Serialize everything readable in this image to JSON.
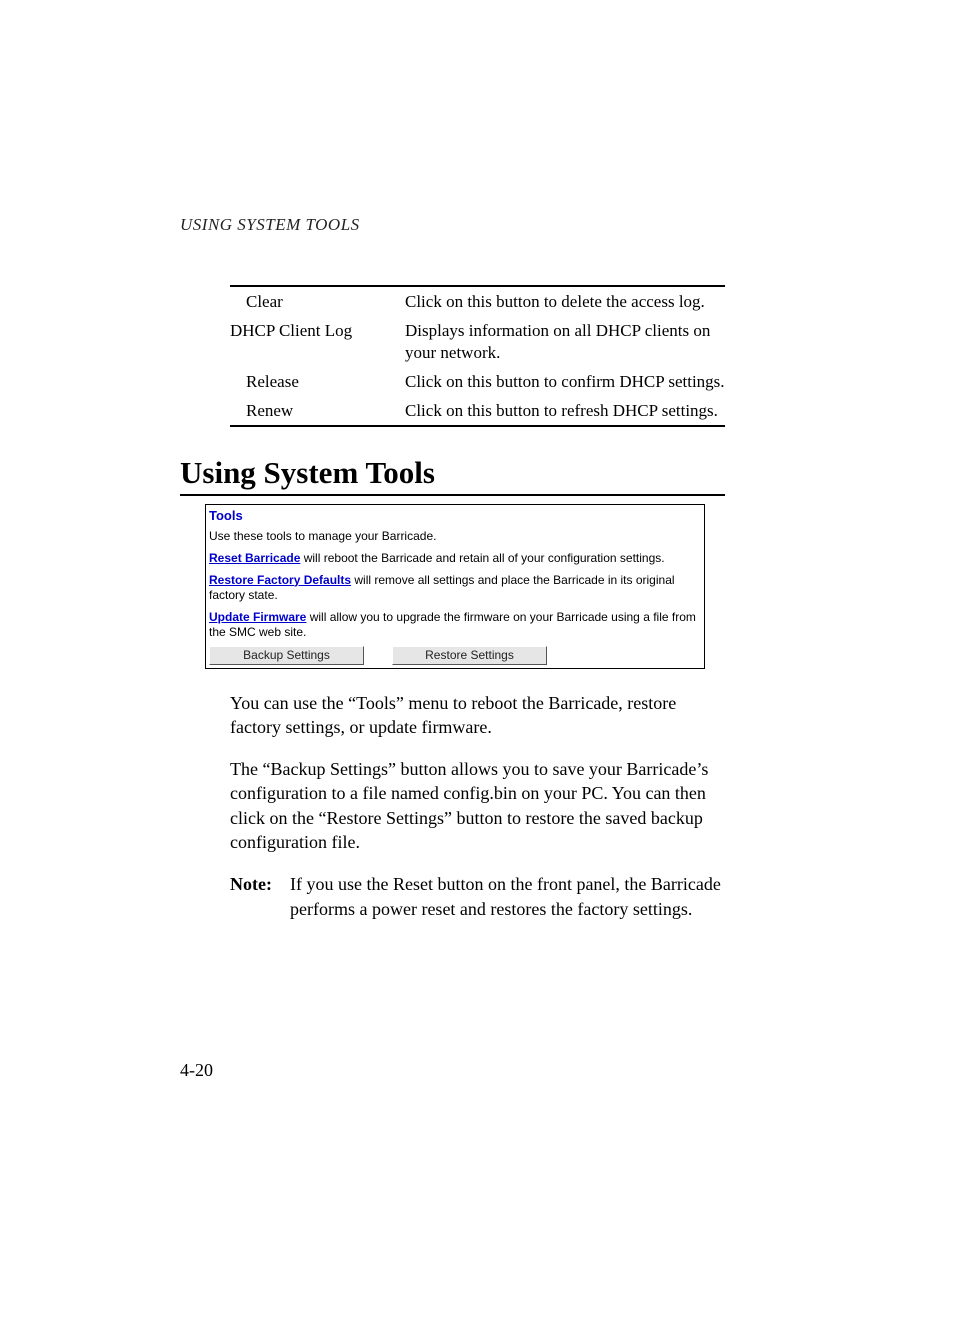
{
  "running_head": "USING SYSTEM TOOLS",
  "ref_table": {
    "rows": [
      {
        "indent": 1,
        "c1": "Clear",
        "c2": "Click on this button to delete the access log."
      },
      {
        "indent": 0,
        "c1": "DHCP Client Log",
        "c2": "Displays information on all DHCP clients on your network."
      },
      {
        "indent": 1,
        "c1": "Release",
        "c2": "Click on this button to confirm DHCP settings."
      },
      {
        "indent": 1,
        "c1": "Renew",
        "c2": "Click on this button to refresh DHCP settings."
      }
    ]
  },
  "section_heading": "Using System Tools",
  "tools_panel": {
    "title": "Tools",
    "intro": "Use these tools to manage your Barricade.",
    "items": [
      {
        "link": "Reset Barricade",
        "rest": " will reboot the Barricade and retain all of your configuration settings."
      },
      {
        "link": "Restore Factory Defaults",
        "rest": " will remove all settings and place the Barricade in its original factory state."
      },
      {
        "link": "Update Firmware",
        "rest": " will allow you to upgrade the firmware on your Barricade using a file from the SMC web site."
      }
    ],
    "backup_btn": "Backup Settings",
    "restore_btn": "Restore Settings"
  },
  "body": {
    "p1": "You can use the “Tools” menu to reboot the Barricade, restore factory settings, or update firmware.",
    "p2": "The “Backup Settings” button allows you to save your Barricade’s configuration to a file named config.bin on your PC. You can then click on the “Restore Settings” button to restore the saved backup configuration file."
  },
  "note": {
    "label": "Note:",
    "text": "If you use the Reset button on the front panel, the Barricade performs a power reset and restores the factory settings."
  },
  "page_number": "4-20"
}
